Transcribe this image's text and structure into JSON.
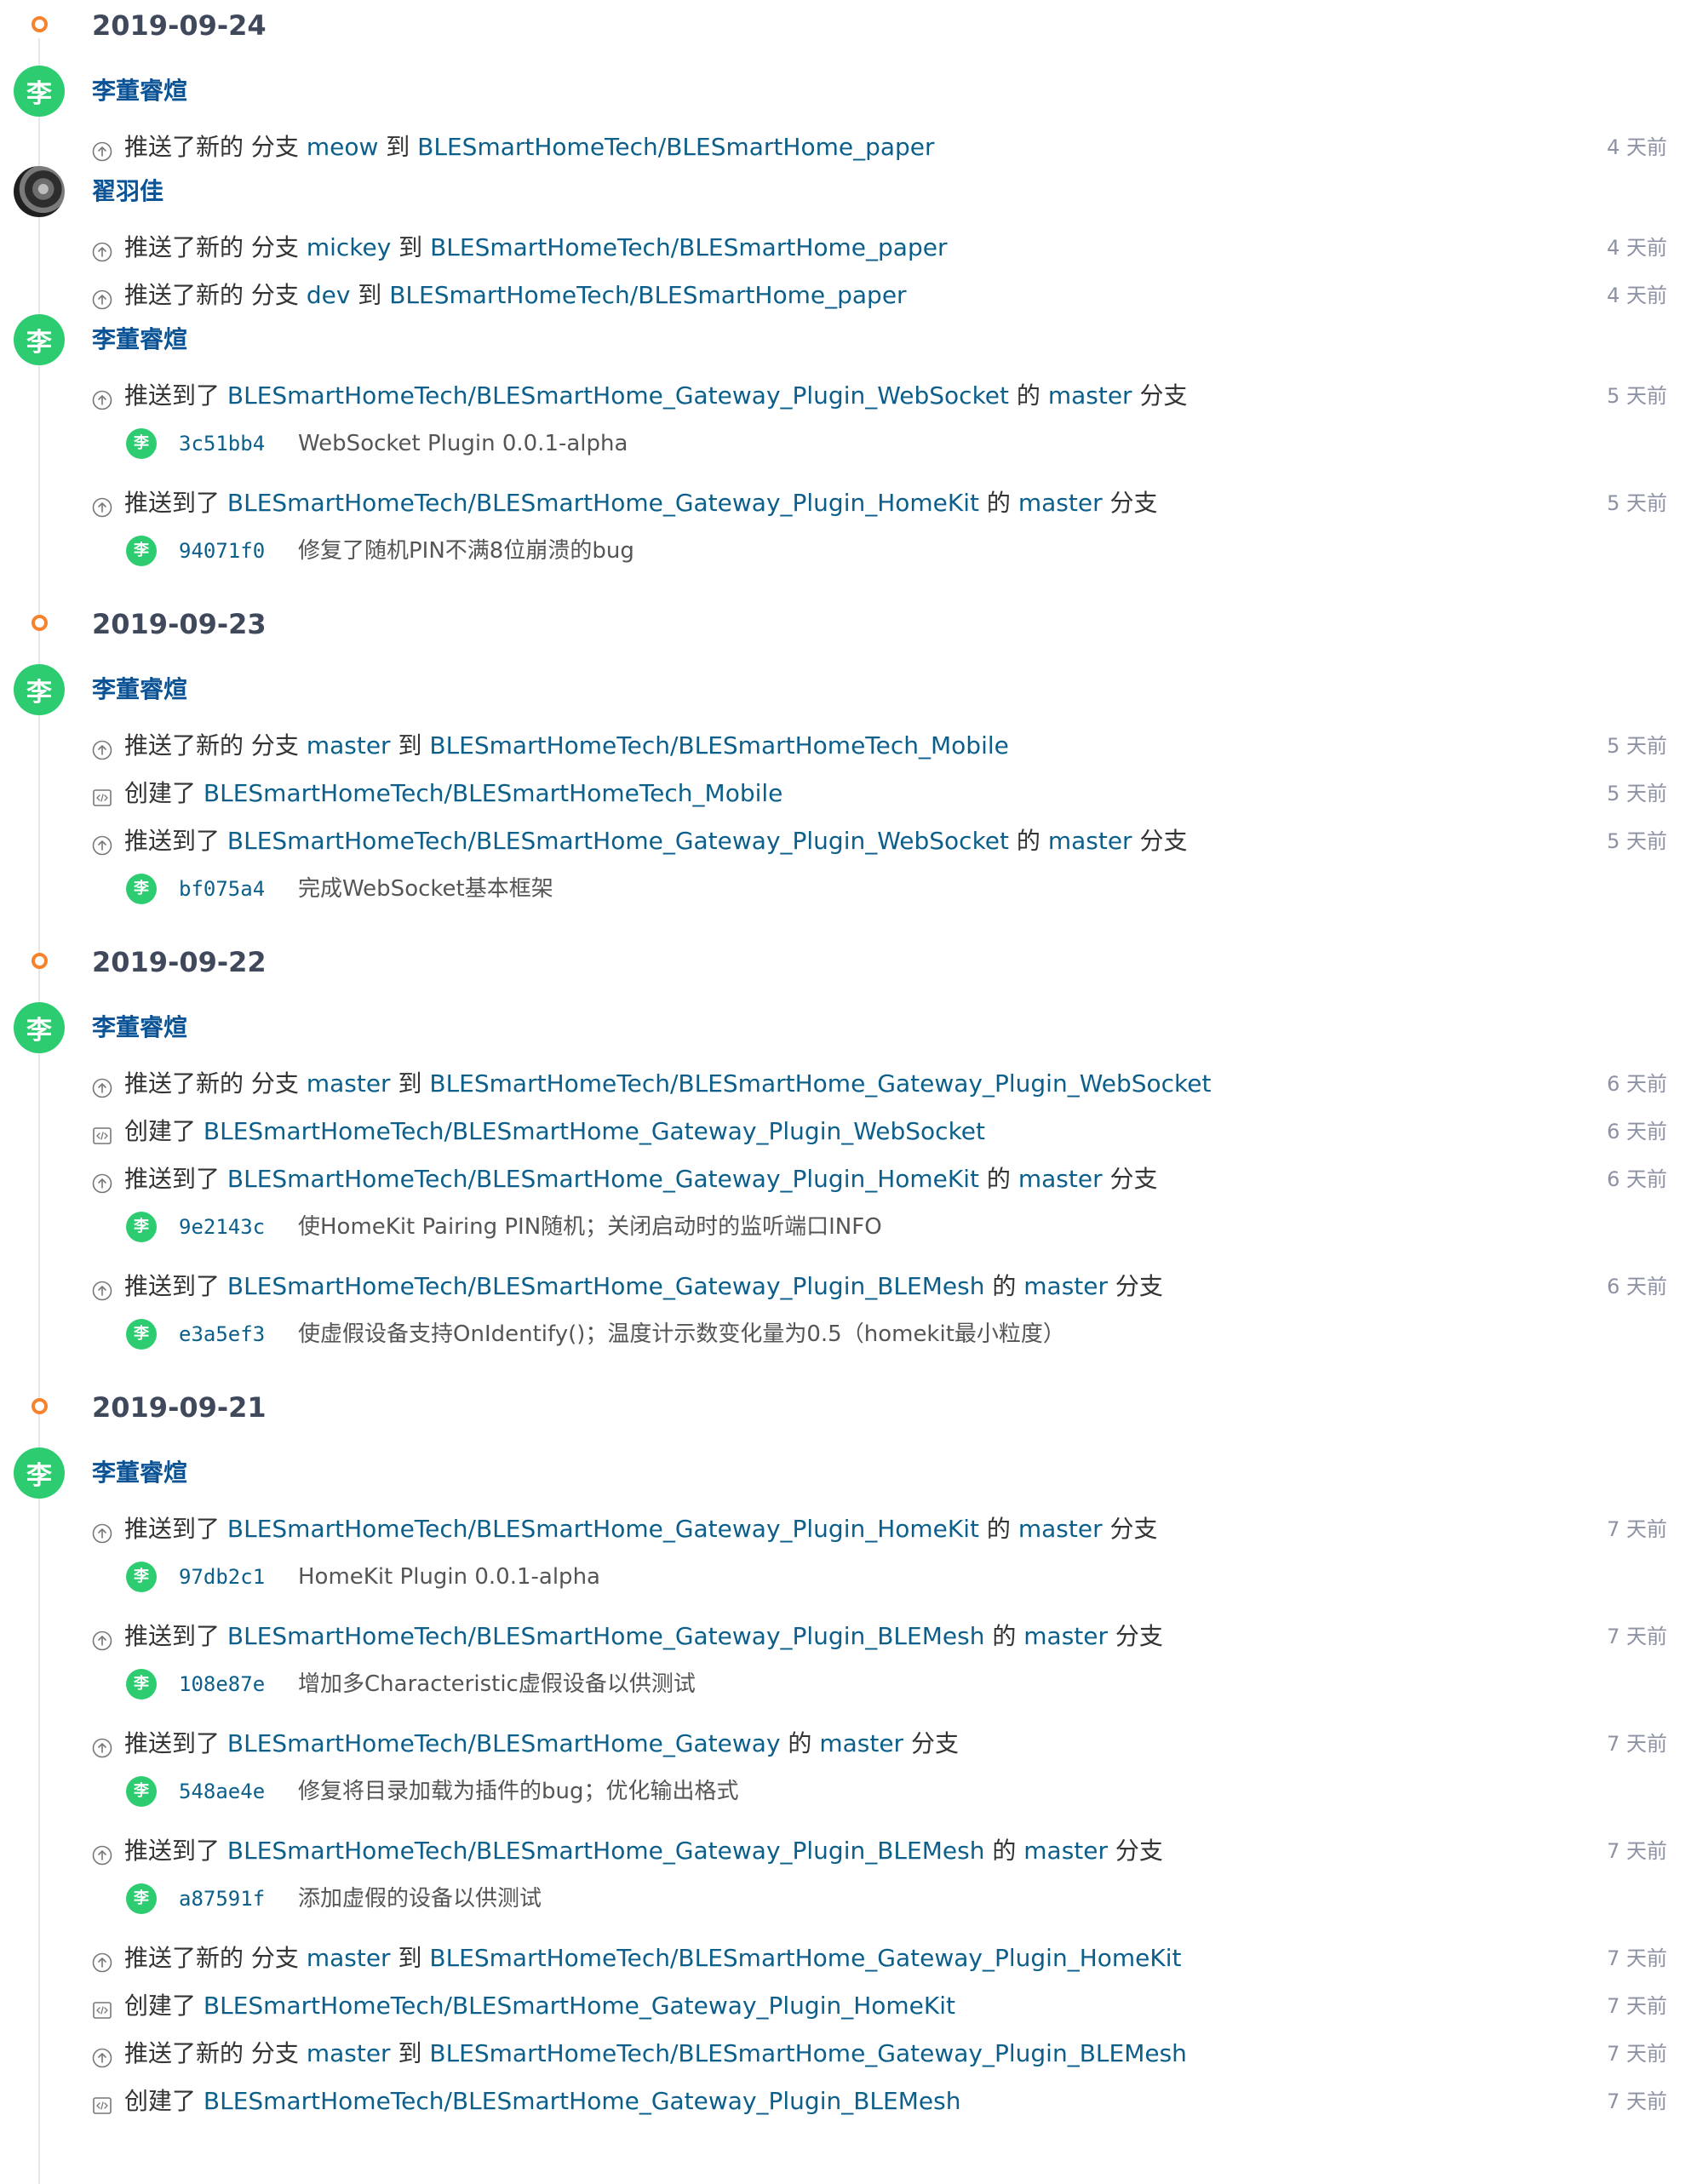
{
  "colors": {
    "accent_link": "#0b5f8a",
    "date_dot": "#f6832c",
    "avatar_green": "#2ecc71",
    "timestamp": "#8c92a4"
  },
  "feed": [
    {
      "type": "date",
      "text": "2019-09-24"
    },
    {
      "type": "user",
      "name": "李董睿煊",
      "avatar_char": "李"
    },
    {
      "type": "event",
      "icon": "push-icon",
      "parts": [
        "推送了新的 分支 ",
        "@meow",
        " 到 ",
        "@BLESmartHomeTech/BLESmartHome_paper"
      ],
      "ago": "4 天前"
    },
    {
      "type": "user",
      "name": "翟羽佳",
      "avatar_char": "",
      "photo": true
    },
    {
      "type": "event",
      "icon": "push-icon",
      "parts": [
        "推送了新的 分支 ",
        "@mickey",
        " 到 ",
        "@BLESmartHomeTech/BLESmartHome_paper"
      ],
      "ago": "4 天前"
    },
    {
      "type": "event",
      "icon": "push-icon",
      "parts": [
        "推送了新的 分支 ",
        "@dev",
        " 到 ",
        "@BLESmartHomeTech/BLESmartHome_paper"
      ],
      "ago": "4 天前"
    },
    {
      "type": "user",
      "name": "李董睿煊",
      "avatar_char": "李"
    },
    {
      "type": "event",
      "icon": "push-icon",
      "parts": [
        "推送到了 ",
        "@BLESmartHomeTech/BLESmartHome_Gateway_Plugin_WebSocket",
        " 的 ",
        "@master",
        " 分支"
      ],
      "ago": "5 天前"
    },
    {
      "type": "commit",
      "avatar_char": "李",
      "sha": "3c51bb4",
      "message": "WebSocket Plugin 0.0.1-alpha"
    },
    {
      "type": "event",
      "icon": "push-icon",
      "parts": [
        "推送到了 ",
        "@BLESmartHomeTech/BLESmartHome_Gateway_Plugin_HomeKit",
        " 的 ",
        "@master",
        " 分支"
      ],
      "ago": "5 天前"
    },
    {
      "type": "commit",
      "avatar_char": "李",
      "sha": "94071f0",
      "message": "修复了随机PIN不满8位崩溃的bug"
    },
    {
      "type": "date",
      "text": "2019-09-23"
    },
    {
      "type": "user",
      "name": "李董睿煊",
      "avatar_char": "李"
    },
    {
      "type": "event",
      "icon": "push-icon",
      "parts": [
        "推送了新的 分支 ",
        "@master",
        " 到 ",
        "@BLESmartHomeTech/BLESmartHomeTech_Mobile"
      ],
      "ago": "5 天前"
    },
    {
      "type": "event",
      "icon": "repo-icon",
      "parts": [
        "创建了 ",
        "@BLESmartHomeTech/BLESmartHomeTech_Mobile"
      ],
      "ago": "5 天前"
    },
    {
      "type": "event",
      "icon": "push-icon",
      "parts": [
        "推送到了 ",
        "@BLESmartHomeTech/BLESmartHome_Gateway_Plugin_WebSocket",
        " 的 ",
        "@master",
        " 分支"
      ],
      "ago": "5 天前"
    },
    {
      "type": "commit",
      "avatar_char": "李",
      "sha": "bf075a4",
      "message": "完成WebSocket基本框架"
    },
    {
      "type": "date",
      "text": "2019-09-22"
    },
    {
      "type": "user",
      "name": "李董睿煊",
      "avatar_char": "李"
    },
    {
      "type": "event",
      "icon": "push-icon",
      "parts": [
        "推送了新的 分支 ",
        "@master",
        " 到 ",
        "@BLESmartHomeTech/BLESmartHome_Gateway_Plugin_WebSocket"
      ],
      "ago": "6 天前"
    },
    {
      "type": "event",
      "icon": "repo-icon",
      "parts": [
        "创建了 ",
        "@BLESmartHomeTech/BLESmartHome_Gateway_Plugin_WebSocket"
      ],
      "ago": "6 天前"
    },
    {
      "type": "event",
      "icon": "push-icon",
      "parts": [
        "推送到了 ",
        "@BLESmartHomeTech/BLESmartHome_Gateway_Plugin_HomeKit",
        " 的 ",
        "@master",
        " 分支"
      ],
      "ago": "6 天前"
    },
    {
      "type": "commit",
      "avatar_char": "李",
      "sha": "9e2143c",
      "message": "使HomeKit Pairing PIN随机；关闭启动时的监听端口INFO"
    },
    {
      "type": "event",
      "icon": "push-icon",
      "parts": [
        "推送到了 ",
        "@BLESmartHomeTech/BLESmartHome_Gateway_Plugin_BLEMesh",
        " 的 ",
        "@master",
        " 分支"
      ],
      "ago": "6 天前"
    },
    {
      "type": "commit",
      "avatar_char": "李",
      "sha": "e3a5ef3",
      "message": "使虚假设备支持OnIdentify()；温度计示数变化量为0.5（homekit最小粒度）"
    },
    {
      "type": "date",
      "text": "2019-09-21"
    },
    {
      "type": "user",
      "name": "李董睿煊",
      "avatar_char": "李"
    },
    {
      "type": "event",
      "icon": "push-icon",
      "parts": [
        "推送到了 ",
        "@BLESmartHomeTech/BLESmartHome_Gateway_Plugin_HomeKit",
        " 的 ",
        "@master",
        " 分支"
      ],
      "ago": "7 天前"
    },
    {
      "type": "commit",
      "avatar_char": "李",
      "sha": "97db2c1",
      "message": "HomeKit Plugin 0.0.1-alpha"
    },
    {
      "type": "event",
      "icon": "push-icon",
      "parts": [
        "推送到了 ",
        "@BLESmartHomeTech/BLESmartHome_Gateway_Plugin_BLEMesh",
        " 的 ",
        "@master",
        " 分支"
      ],
      "ago": "7 天前"
    },
    {
      "type": "commit",
      "avatar_char": "李",
      "sha": "108e87e",
      "message": "增加多Characteristic虚假设备以供测试"
    },
    {
      "type": "event",
      "icon": "push-icon",
      "parts": [
        "推送到了 ",
        "@BLESmartHomeTech/BLESmartHome_Gateway",
        " 的 ",
        "@master",
        " 分支"
      ],
      "ago": "7 天前"
    },
    {
      "type": "commit",
      "avatar_char": "李",
      "sha": "548ae4e",
      "message": "修复将目录加载为插件的bug；优化输出格式"
    },
    {
      "type": "event",
      "icon": "push-icon",
      "parts": [
        "推送到了 ",
        "@BLESmartHomeTech/BLESmartHome_Gateway_Plugin_BLEMesh",
        " 的 ",
        "@master",
        " 分支"
      ],
      "ago": "7 天前"
    },
    {
      "type": "commit",
      "avatar_char": "李",
      "sha": "a87591f",
      "message": "添加虚假的设备以供测试"
    },
    {
      "type": "event",
      "icon": "push-icon",
      "parts": [
        "推送了新的 分支 ",
        "@master",
        " 到 ",
        "@BLESmartHomeTech/BLESmartHome_Gateway_Plugin_HomeKit"
      ],
      "ago": "7 天前"
    },
    {
      "type": "event",
      "icon": "repo-icon",
      "parts": [
        "创建了 ",
        "@BLESmartHomeTech/BLESmartHome_Gateway_Plugin_HomeKit"
      ],
      "ago": "7 天前"
    },
    {
      "type": "event",
      "icon": "push-icon",
      "parts": [
        "推送了新的 分支 ",
        "@master",
        " 到 ",
        "@BLESmartHomeTech/BLESmartHome_Gateway_Plugin_BLEMesh"
      ],
      "ago": "7 天前"
    },
    {
      "type": "event",
      "icon": "repo-icon",
      "parts": [
        "创建了 ",
        "@BLESmartHomeTech/BLESmartHome_Gateway_Plugin_BLEMesh"
      ],
      "ago": "7 天前"
    }
  ]
}
